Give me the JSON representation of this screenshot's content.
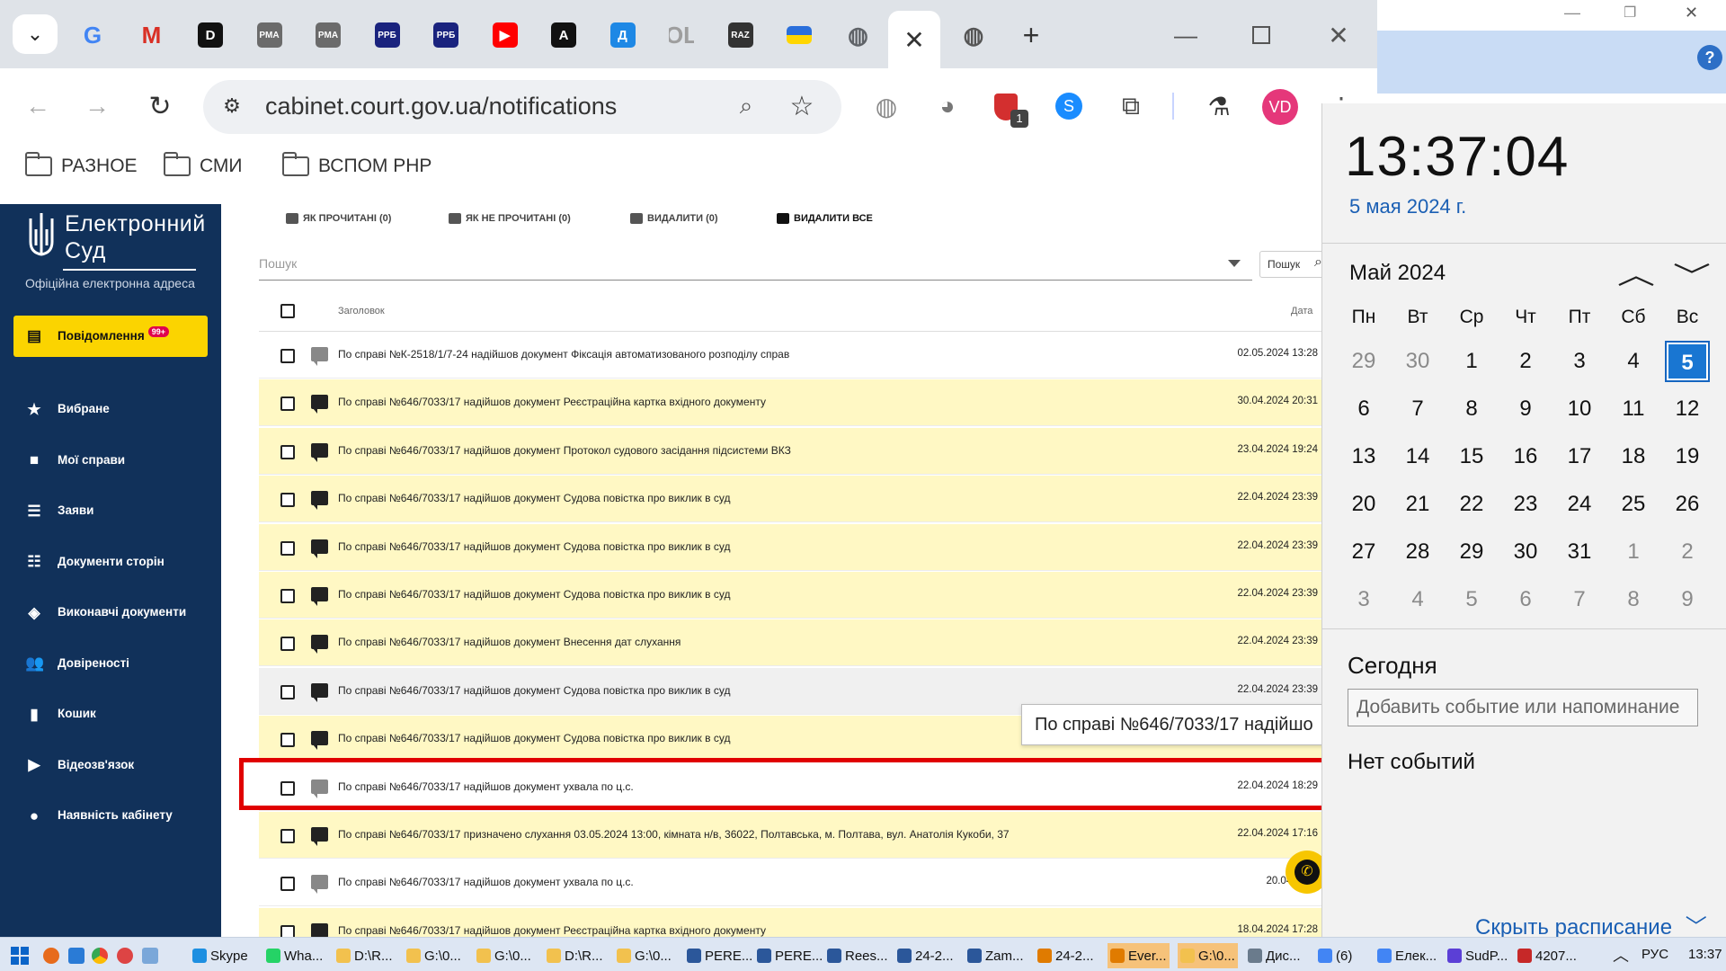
{
  "browser": {
    "url": "cabinet.court.gov.ua/notifications",
    "tabs": [
      {
        "id": "google",
        "glyph": "G",
        "color": "#4285f4"
      },
      {
        "id": "gmail",
        "glyph": "M",
        "color": "#d93025"
      },
      {
        "id": "d",
        "glyph": "D",
        "color": "#111111"
      },
      {
        "id": "pma1",
        "glyph": "PMA",
        "color": "#6b6b6b"
      },
      {
        "id": "pma2",
        "glyph": "PMA",
        "color": "#6b6b6b"
      },
      {
        "id": "ppb1",
        "glyph": "PPБ",
        "color": "#1a237e"
      },
      {
        "id": "ppb2",
        "glyph": "PPБ",
        "color": "#1a237e"
      },
      {
        "id": "youtube",
        "glyph": "▶",
        "color": "#ff0000"
      },
      {
        "id": "a",
        "glyph": "A",
        "color": "#111111"
      },
      {
        "id": "d2",
        "glyph": "Д",
        "color": "#1e88e5"
      },
      {
        "id": "ol",
        "glyph": "OL",
        "color": "#9e9e9e"
      },
      {
        "id": "raz",
        "glyph": "RAZ",
        "color": "#333333"
      },
      {
        "id": "ua",
        "glyph": "",
        "color": "#ffd600"
      },
      {
        "id": "globe1",
        "glyph": "◍",
        "color": "#5f6368"
      }
    ],
    "bookmarks": [
      "РАЗНОЕ",
      "СМИ",
      "ВСПОМ PHP"
    ],
    "ext_badge": "1",
    "profile": "VD"
  },
  "sidebar": {
    "logo_line1": "Електронний",
    "logo_line2": "Суд",
    "logo_sub": "Офіційна електронна адреса",
    "items": [
      {
        "label": "Повідомлення",
        "badge": "99+",
        "icon": "message-icon",
        "active": true
      },
      {
        "label": "Вибране",
        "icon": "star-icon"
      },
      {
        "label": "Мої справи",
        "icon": "folder-icon"
      },
      {
        "label": "Заяви",
        "icon": "list-icon"
      },
      {
        "label": "Документи сторін",
        "icon": "checklist-icon"
      },
      {
        "label": "Виконавчі документи",
        "icon": "layers-icon"
      },
      {
        "label": "Довіреності",
        "icon": "people-icon"
      },
      {
        "label": "Кошик",
        "icon": "trash-icon"
      },
      {
        "label": "Відеозв'язок",
        "icon": "video-icon"
      },
      {
        "label": "Наявність кабінету",
        "icon": "person-icon"
      }
    ]
  },
  "notifications": {
    "actions": [
      "ЯК ПРОЧИТАНІ (0)",
      "ЯК НЕ ПРОЧИТАНІ (0)",
      "ВИДАЛИТИ (0)",
      "ВИДАЛИТИ ВСЕ"
    ],
    "search_placeholder": "Пошук",
    "search_button": "Пошук",
    "col_title": "Заголовок",
    "col_date": "Дата",
    "tooltip": "По справі №646/7033/17 надійшо",
    "rows": [
      {
        "text": "По справі №К-2518/1/7-24 надійшов документ Фіксація автоматизованого розподілу справ",
        "date": "02.05.2024 13:28",
        "style": "white",
        "icon": "light"
      },
      {
        "text": "По справі №646/7033/17 надійшов документ Реєстраційна картка вхідного документу",
        "date": "30.04.2024 20:31",
        "style": "yellow",
        "icon": "dark"
      },
      {
        "text": "По справі №646/7033/17 надійшов документ Протокол судового засідання підсистеми ВКЗ",
        "date": "23.04.2024 19:24",
        "style": "yellow",
        "icon": "dark"
      },
      {
        "text": "По справі №646/7033/17 надійшов документ Судова повістка про виклик в суд",
        "date": "22.04.2024 23:39",
        "style": "yellow",
        "icon": "dark"
      },
      {
        "text": "По справі №646/7033/17 надійшов документ Судова повістка про виклик в суд",
        "date": "22.04.2024 23:39",
        "style": "yellow",
        "icon": "dark"
      },
      {
        "text": "По справі №646/7033/17 надійшов документ Судова повістка про виклик в суд",
        "date": "22.04.2024 23:39",
        "style": "yellow",
        "icon": "dark"
      },
      {
        "text": "По справі №646/7033/17 надійшов документ Внесення дат слухання",
        "date": "22.04.2024 23:39",
        "style": "yellow",
        "icon": "dark"
      },
      {
        "text": "По справі №646/7033/17 надійшов документ Судова повістка про виклик в суд",
        "date": "22.04.2024 23:39",
        "style": "grey",
        "icon": "dark"
      },
      {
        "text": "По справі №646/7033/17 надійшов документ Судова повістка про виклик в суд",
        "date": "",
        "style": "yellow",
        "icon": "dark"
      },
      {
        "text": "По справі №646/7033/17 надійшов документ ухвала по ц.с.",
        "date": "22.04.2024 18:29",
        "style": "white",
        "icon": "light"
      },
      {
        "text": "По справі №646/7033/17 призначено слухання 03.05.2024 13:00, кімната н/в, 36022, Полтавська, м. Полтава, вул. Анатолія Кукоби, 37",
        "date": "22.04.2024 17:16",
        "style": "yellow",
        "icon": "dark"
      },
      {
        "text": "По справі №646/7033/17 надійшов документ ухвала по ц.с.",
        "date": "20.04.2024",
        "style": "white",
        "icon": "light"
      },
      {
        "text": "По справі №646/7033/17 надійшов документ Реєстраційна картка вхідного документу",
        "date": "18.04.2024 17:28",
        "style": "yellow",
        "icon": "dark"
      }
    ]
  },
  "calendar": {
    "time": "13:37:04",
    "date": "5 мая 2024 г.",
    "month": "Май 2024",
    "weekdays": [
      "Пн",
      "Вт",
      "Ср",
      "Чт",
      "Пт",
      "Сб",
      "Вс"
    ],
    "days": [
      [
        "29",
        "30",
        "1",
        "2",
        "3",
        "4",
        "5"
      ],
      [
        "6",
        "7",
        "8",
        "9",
        "10",
        "11",
        "12"
      ],
      [
        "13",
        "14",
        "15",
        "16",
        "17",
        "18",
        "19"
      ],
      [
        "20",
        "21",
        "22",
        "23",
        "24",
        "25",
        "26"
      ],
      [
        "27",
        "28",
        "29",
        "30",
        "31",
        "1",
        "2"
      ],
      [
        "3",
        "4",
        "5",
        "6",
        "7",
        "8",
        "9"
      ]
    ],
    "today": "5",
    "section": "Сегодня",
    "event_placeholder": "Добавить событие или напоминание",
    "no_events": "Нет событий",
    "hide": "Скрыть расписание"
  },
  "taskbar": {
    "items": [
      "Skype",
      "Wha...",
      "D:\\R...",
      "G:\\0...",
      "G:\\0...",
      "D:\\R...",
      "G:\\0...",
      "PERE...",
      "PERE...",
      "Rees...",
      "24-2...",
      "Zam...",
      "24-2...",
      "Ever...",
      "G:\\0...",
      "Дис...",
      "(6)",
      "Елек...",
      "SudP...",
      "4207..."
    ],
    "lang": "РУС",
    "clock": "13:37"
  }
}
